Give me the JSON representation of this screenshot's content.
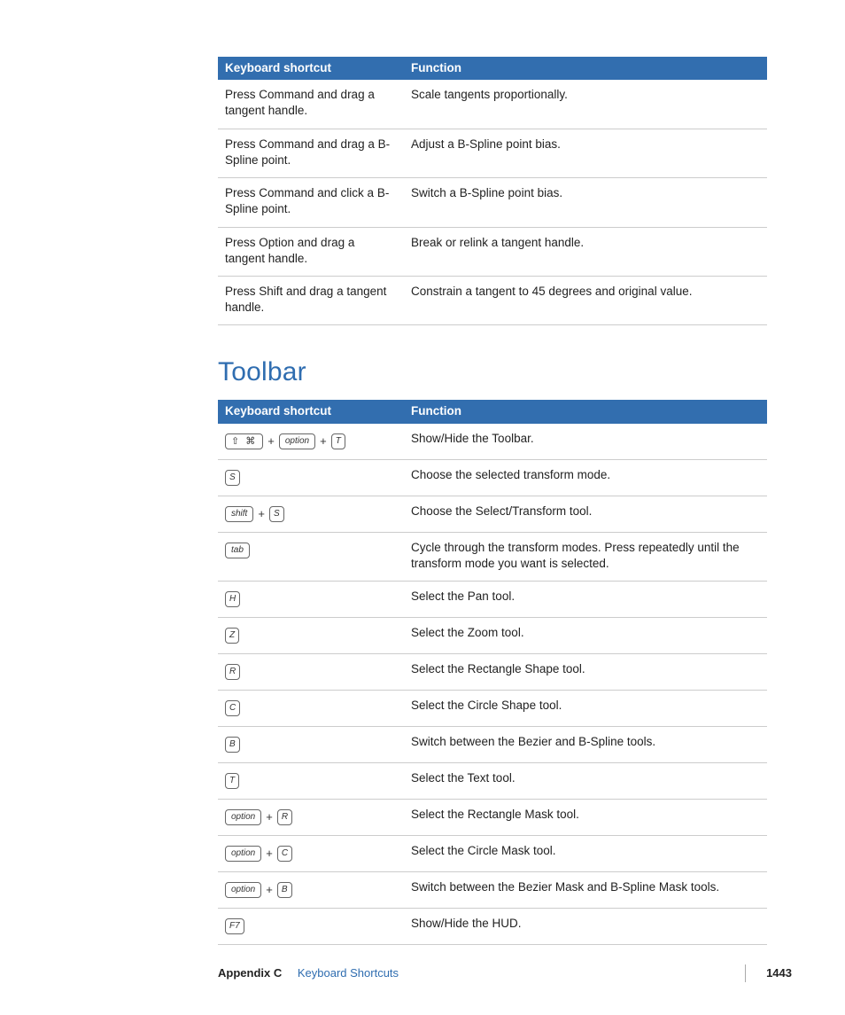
{
  "table1": {
    "headers": {
      "col1": "Keyboard shortcut",
      "col2": "Function"
    },
    "rows": [
      {
        "shortcut": "Press Command and drag a tangent handle.",
        "function": "Scale tangents proportionally."
      },
      {
        "shortcut": "Press Command and drag a B-Spline point.",
        "function": "Adjust a B-Spline point bias."
      },
      {
        "shortcut": "Press Command and click a B-Spline point.",
        "function": "Switch a B-Spline point bias."
      },
      {
        "shortcut": "Press Option and drag a tangent handle.",
        "function": "Break or relink a tangent handle."
      },
      {
        "shortcut": "Press Shift and drag a tangent handle.",
        "function": "Constrain a tangent to 45 degrees and original value."
      }
    ]
  },
  "section_title": "Toolbar",
  "table2": {
    "headers": {
      "col1": "Keyboard shortcut",
      "col2": "Function"
    },
    "rows": [
      {
        "keys": [
          "cmd",
          "option",
          "T"
        ],
        "function": "Show/Hide the Toolbar."
      },
      {
        "keys": [
          "S"
        ],
        "function": "Choose the selected transform mode."
      },
      {
        "keys": [
          "shift",
          "S"
        ],
        "function": "Choose the Select/Transform tool."
      },
      {
        "keys": [
          "tab"
        ],
        "function": "Cycle through the transform modes. Press repeatedly until the transform mode you want is selected."
      },
      {
        "keys": [
          "H"
        ],
        "function": "Select the Pan tool."
      },
      {
        "keys": [
          "Z"
        ],
        "function": "Select the Zoom tool."
      },
      {
        "keys": [
          "R"
        ],
        "function": "Select the Rectangle Shape tool."
      },
      {
        "keys": [
          "C"
        ],
        "function": "Select the Circle Shape tool."
      },
      {
        "keys": [
          "B"
        ],
        "function": "Switch between the Bezier and B-Spline tools."
      },
      {
        "keys": [
          "T"
        ],
        "function": "Select the Text tool."
      },
      {
        "keys": [
          "option",
          "R"
        ],
        "function": "Select the Rectangle Mask tool."
      },
      {
        "keys": [
          "option",
          "C"
        ],
        "function": "Select the Circle Mask tool."
      },
      {
        "keys": [
          "option",
          "B"
        ],
        "function": "Switch between the Bezier Mask and B-Spline Mask tools."
      },
      {
        "keys": [
          "F7"
        ],
        "function": "Show/Hide the HUD."
      }
    ]
  },
  "key_labels": {
    "cmd": "⌘",
    "cmd_prefix": "⇧ ⌘",
    "option": "option",
    "shift": "shift",
    "tab": "tab"
  },
  "footer": {
    "appendix": "Appendix C",
    "title": "Keyboard Shortcuts",
    "page": "1443"
  }
}
